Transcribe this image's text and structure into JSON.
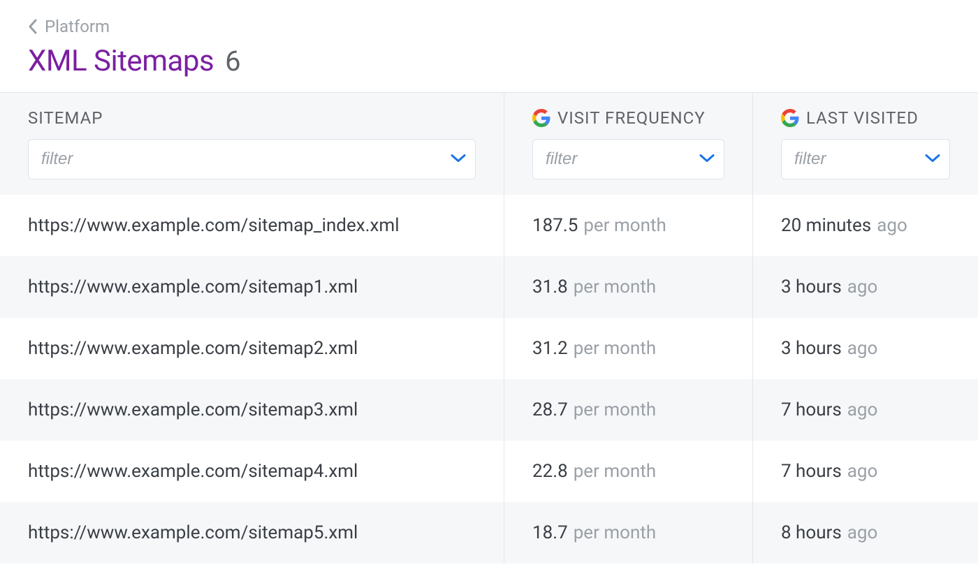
{
  "breadcrumb": {
    "label": "Platform"
  },
  "title": "XML Sitemaps",
  "count": "6",
  "columns": {
    "sitemap": {
      "label": "SITEMAP",
      "filter_placeholder": "filter"
    },
    "visit_frequency": {
      "label": "VISIT FREQUENCY",
      "filter_placeholder": "filter"
    },
    "last_visited": {
      "label": "LAST VISITED",
      "filter_placeholder": "filter"
    }
  },
  "rows": [
    {
      "sitemap": "https://www.example.com/sitemap_index.xml",
      "freq_value": "187.5",
      "freq_unit": "per month",
      "visited_value": "20 minutes",
      "visited_suffix": "ago"
    },
    {
      "sitemap": "https://www.example.com/sitemap1.xml",
      "freq_value": "31.8",
      "freq_unit": "per month",
      "visited_value": "3 hours",
      "visited_suffix": "ago"
    },
    {
      "sitemap": "https://www.example.com/sitemap2.xml",
      "freq_value": "31.2",
      "freq_unit": "per month",
      "visited_value": "3 hours",
      "visited_suffix": "ago"
    },
    {
      "sitemap": "https://www.example.com/sitemap3.xml",
      "freq_value": "28.7",
      "freq_unit": "per month",
      "visited_value": "7 hours",
      "visited_suffix": "ago"
    },
    {
      "sitemap": "https://www.example.com/sitemap4.xml",
      "freq_value": "22.8",
      "freq_unit": "per month",
      "visited_value": "7 hours",
      "visited_suffix": "ago"
    },
    {
      "sitemap": "https://www.example.com/sitemap5.xml",
      "freq_value": "18.7",
      "freq_unit": "per month",
      "visited_value": "8 hours",
      "visited_suffix": "ago"
    }
  ]
}
